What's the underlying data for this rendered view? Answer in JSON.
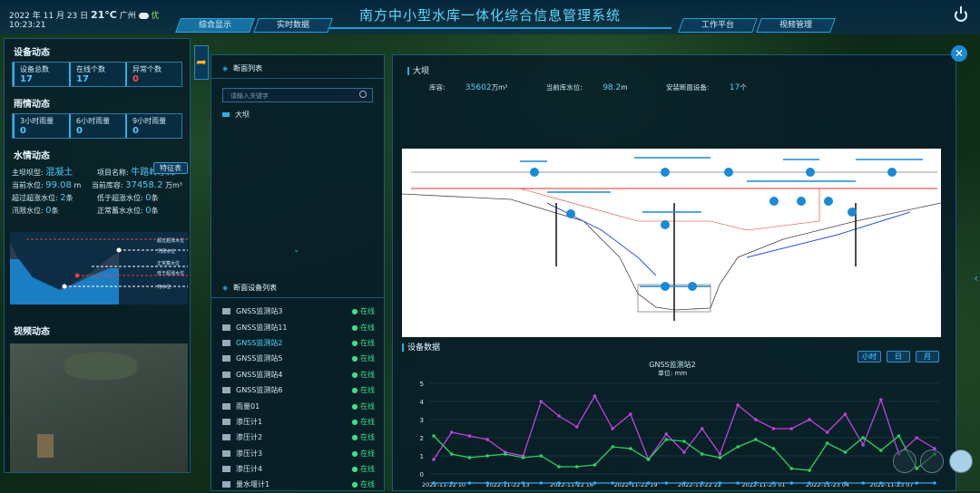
{
  "header": {
    "date": "2022 年 11 月 23 日",
    "temp": "21°C",
    "city": "广州",
    "weather": "优",
    "time": "10:23:21",
    "title": "南方中小型水库一体化综合信息管理系统",
    "tabs": [
      "综合显示",
      "实时数据",
      "工作平台",
      "视频管理"
    ]
  },
  "left": {
    "equip_title": "设备动态",
    "equip": [
      {
        "label": "设备总数",
        "value": "17"
      },
      {
        "label": "在线个数",
        "value": "17"
      },
      {
        "label": "异常个数",
        "value": "0"
      }
    ],
    "rain_title": "雨情动态",
    "rain": [
      {
        "label": "3小时雨量",
        "value": "0"
      },
      {
        "label": "6小时雨量",
        "value": "0"
      },
      {
        "label": "9小时雨量",
        "value": "0"
      }
    ],
    "water_title": "水情动态",
    "feature_btn": "特征表",
    "dam_type_label": "主坝坝型:",
    "dam_type": "混凝土",
    "proj_label": "项目名称:",
    "proj": "牛路岭水库",
    "level_label": "当前水位:",
    "level": "99.08",
    "level_unit": "m",
    "storage_label": "当前库容:",
    "storage": "37458.2",
    "storage_unit": "万m³",
    "over_label": "超过超涨水位:",
    "over": "2",
    "under_label": "低于超涨水位:",
    "under": "0",
    "cnt_unit": "条",
    "flood_label": "汛限水位:",
    "flood": "0",
    "normal_label": "正常蓄水水位:",
    "normal": "0",
    "profile_labels": [
      "超过超涨水位",
      "汛限水位",
      "正常蓄水位",
      "低于超涨水位",
      "死水位"
    ],
    "video_title": "视频动态"
  },
  "mid": {
    "list_title": "断面列表",
    "search_placeholder": "请输入关键字",
    "dam": "大坝",
    "dev_title": "断面设备列表",
    "devices": [
      {
        "name": "GNSS监测站3",
        "status": "在线"
      },
      {
        "name": "GNSS监测站11",
        "status": "在线"
      },
      {
        "name": "GNSS监测站2",
        "status": "在线"
      },
      {
        "name": "GNSS监测站5",
        "status": "在线"
      },
      {
        "name": "GNSS监测站4",
        "status": "在线"
      },
      {
        "name": "GNSS监测站6",
        "status": "在线"
      },
      {
        "name": "雨量01",
        "status": "在线"
      },
      {
        "name": "渗压计1",
        "status": "在线"
      },
      {
        "name": "渗压计2",
        "status": "在线"
      },
      {
        "name": "渗压计3",
        "status": "在线"
      },
      {
        "name": "渗压计4",
        "status": "在线"
      },
      {
        "name": "量水堰计1",
        "status": "在线"
      }
    ]
  },
  "main": {
    "title": "大坝",
    "capacity_label": "库容:",
    "capacity": "35602",
    "capacity_unit": "万m³",
    "level_label": "当前库水位:",
    "level": "98.2",
    "level_unit": "m",
    "count_label": "安装断面设备:",
    "count": "17",
    "count_unit": "个",
    "dev_data_title": "设备数据",
    "time_btns": [
      "小时",
      "日",
      "月"
    ]
  },
  "chart_data": {
    "type": "line",
    "title": "GNSS监测站2",
    "subtitle": "单位: mm",
    "ylim": [
      0,
      5
    ],
    "yticks": [
      "0",
      "1",
      "2",
      "3",
      "4",
      "5"
    ],
    "xticks": [
      "2022-11-22 10",
      "2022-11-22 13",
      "2022-11-22 16",
      "2022-11-22 19",
      "2022-11-22 22",
      "2022-11-23 01",
      "2022-11-23 04",
      "2022-11-23 07"
    ],
    "n": 24,
    "series": [
      {
        "color": "#c040e0",
        "values": [
          0.8,
          2.3,
          2.1,
          1.9,
          1.2,
          1.0,
          4.0,
          3.2,
          2.6,
          4.3,
          2.5,
          3.3,
          0.8,
          2.2,
          1.2,
          2.5,
          1.1,
          3.8,
          3.0,
          2.5,
          2.5,
          3.0,
          2.3,
          3.3,
          1.6,
          4.1,
          1.1,
          2.0,
          1.4
        ]
      },
      {
        "color": "#30d060",
        "values": [
          2.1,
          1.1,
          0.9,
          1.0,
          1.1,
          0.9,
          1.0,
          0.4,
          0.4,
          0.5,
          1.5,
          1.4,
          0.8,
          1.9,
          1.8,
          1.1,
          0.9,
          1.5,
          1.9,
          1.4,
          0.3,
          0.2,
          1.7,
          1.2,
          2.0,
          1.3,
          2.1,
          0.3,
          1.1
        ]
      },
      {
        "color": "#30a8e8",
        "values": [
          -0.5,
          -0.5,
          -0.5,
          -0.5,
          -0.5,
          -0.5,
          -0.5,
          -0.5,
          -0.5,
          -0.5,
          -0.5,
          -0.5,
          -0.5,
          -0.5,
          -0.5,
          -0.5,
          -0.5,
          -0.5,
          -0.5,
          -0.5,
          -0.5,
          -0.5,
          -0.5,
          -0.5,
          -0.5,
          -0.5,
          -0.5,
          -0.5,
          -0.5
        ]
      }
    ]
  }
}
